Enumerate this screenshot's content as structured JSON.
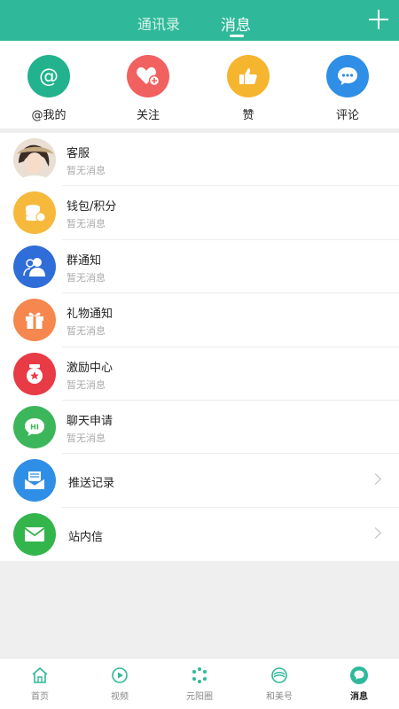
{
  "header": {
    "tabs": [
      "通讯录",
      "消息"
    ],
    "active_tab": "消息"
  },
  "quick_actions": [
    {
      "label": "@我的",
      "icon": "at-icon",
      "color": "#22b38e"
    },
    {
      "label": "关注",
      "icon": "heart-plus-icon",
      "color": "#f0615f"
    },
    {
      "label": "赞",
      "icon": "thumbs-up-icon",
      "color": "#f6b52e"
    },
    {
      "label": "评论",
      "icon": "comment-icon",
      "color": "#2f8ee5"
    }
  ],
  "messages": [
    {
      "title": "客服",
      "subtitle": "暂无消息",
      "icon": "avatar",
      "color": "#e8d8c8"
    },
    {
      "title": "钱包/积分",
      "subtitle": "暂无消息",
      "icon": "coins-icon",
      "color": "#f6b93b"
    },
    {
      "title": "群通知",
      "subtitle": "暂无消息",
      "icon": "group-icon",
      "color": "#2f6ed8"
    },
    {
      "title": "礼物通知",
      "subtitle": "暂无消息",
      "icon": "gift-icon",
      "color": "#f5874f"
    },
    {
      "title": "激励中心",
      "subtitle": "暂无消息",
      "icon": "badge-icon",
      "color": "#e83b45"
    },
    {
      "title": "聊天申请",
      "subtitle": "暂无消息",
      "icon": "chat-hi-icon",
      "color": "#3cb65a"
    }
  ],
  "links": [
    {
      "title": "推送记录",
      "icon": "push-icon",
      "color": "#2f8ee5"
    },
    {
      "title": "站内信",
      "icon": "mail-icon",
      "color": "#33b54c"
    }
  ],
  "bottom_nav": [
    {
      "label": "首页",
      "icon": "home-icon"
    },
    {
      "label": "视频",
      "icon": "video-icon"
    },
    {
      "label": "元阳圈",
      "icon": "circle-icon"
    },
    {
      "label": "和美号",
      "icon": "hemei-icon"
    },
    {
      "label": "消息",
      "icon": "message-icon",
      "active": true
    }
  ],
  "colors": {
    "accent": "#2fb99a"
  }
}
